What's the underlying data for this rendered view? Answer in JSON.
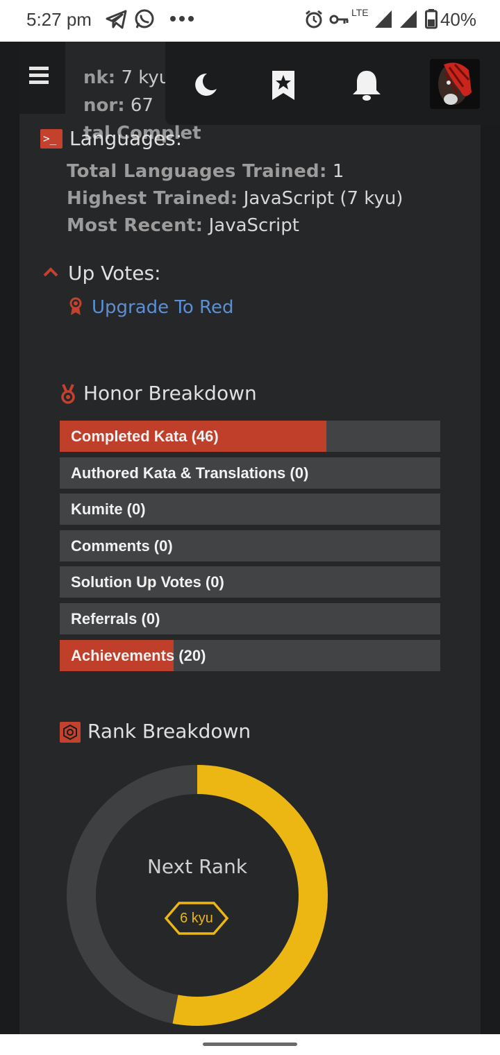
{
  "status_bar": {
    "time": "5:27 pm",
    "network": "LTE",
    "battery": "40%"
  },
  "peek_stats": {
    "rank_label": "nk:",
    "rank_value": "7 kyu",
    "honor_label": "nor:",
    "honor_value": "67",
    "total_label": "tal Complet"
  },
  "nav": {
    "icons": [
      "menu-icon",
      "moon-icon",
      "bookmark-star-icon",
      "bell-icon"
    ]
  },
  "languages": {
    "heading": "Languages:",
    "total_label": "Total Languages Trained:",
    "total_value": "1",
    "highest_label": "Highest Trained:",
    "highest_value": "JavaScript (7 kyu)",
    "recent_label": "Most Recent:",
    "recent_value": "JavaScript"
  },
  "upvotes": {
    "heading": "Up Votes:",
    "link": "Upgrade To Red"
  },
  "honor": {
    "heading": "Honor Breakdown",
    "bars": [
      {
        "label": "Completed Kata (46)",
        "fraction": 0.7
      },
      {
        "label": "Authored Kata & Translations (0)",
        "fraction": 0
      },
      {
        "label": "Kumite (0)",
        "fraction": 0
      },
      {
        "label": "Comments (0)",
        "fraction": 0
      },
      {
        "label": "Solution Up Votes (0)",
        "fraction": 0
      },
      {
        "label": "Referrals (0)",
        "fraction": 0
      },
      {
        "label": "Achievements (20)",
        "fraction": 0.3
      }
    ]
  },
  "rank": {
    "heading": "Rank Breakdown",
    "next_rank_label": "Next Rank",
    "next_rank_value": "6 kyu",
    "progress_fraction": 0.53,
    "progress_color": "#ecb613",
    "track_color": "#3f4042"
  },
  "colors": {
    "accent_red": "#bf3f2b",
    "link_blue": "#5b8fd6",
    "rank_yellow": "#ecb613"
  }
}
